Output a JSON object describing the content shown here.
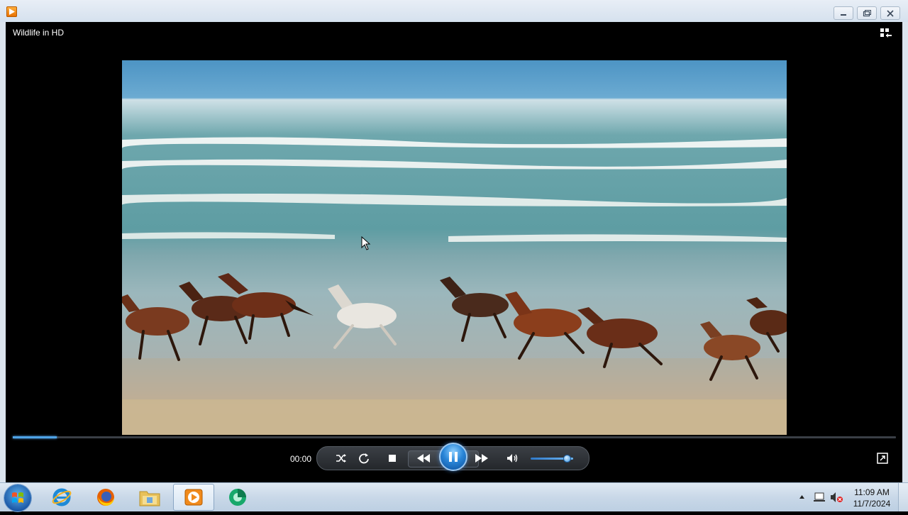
{
  "window": {
    "minimize_label": "Minimize",
    "restore_label": "Restore Down",
    "close_label": "Close"
  },
  "player": {
    "video_title": "Wildlife in HD",
    "elapsed_time": "00:00",
    "progress_fraction": 0.05,
    "volume_fraction": 0.85,
    "state": "playing",
    "accent_color": "#2a86d8"
  },
  "controls": {
    "icons": [
      "shuffle-icon",
      "repeat-icon",
      "stop-icon",
      "previous-icon",
      "pause-icon",
      "next-icon",
      "volume-icon",
      "switch-to-library-icon",
      "switch-view-icon"
    ]
  },
  "taskbar": {
    "items": [
      "start-button",
      "internet-explorer-icon",
      "firefox-icon",
      "file-explorer-icon",
      "windows-media-player-icon",
      "green-app-icon"
    ],
    "active_item": "windows-media-player-icon"
  },
  "tray": {
    "time": "11:09 AM",
    "date": "11/7/2024"
  }
}
